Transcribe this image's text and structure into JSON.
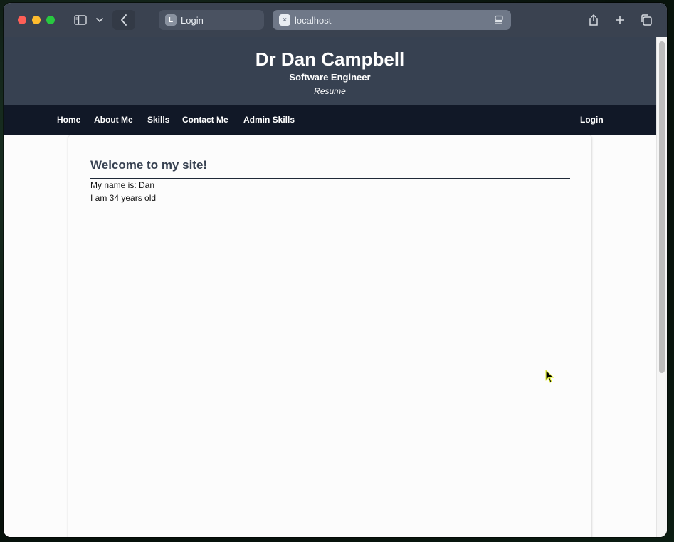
{
  "browser": {
    "tabs": [
      {
        "label": "Login",
        "favicon_letter": "L"
      },
      {
        "label": "localhost",
        "favicon_letter": "×"
      }
    ]
  },
  "header": {
    "title": "Dr Dan Campbell",
    "subtitle": "Software Engineer",
    "tagline": "Resume"
  },
  "nav": {
    "items": [
      "Home",
      "About Me",
      "Skills",
      "Contact Me",
      "Admin Skills"
    ],
    "login": "Login"
  },
  "main": {
    "heading": "Welcome to my site!",
    "name_line": "My name is: Dan",
    "age_line": "I am 34 years old"
  },
  "colors": {
    "header_bg": "#374151",
    "nav_bg": "#111827",
    "heading_text": "#374151"
  },
  "icons": [
    "sidebar-icon",
    "chevron-down-icon",
    "back-arrow-icon",
    "reader-icon",
    "share-icon",
    "plus-icon",
    "tabs-overview-icon"
  ]
}
